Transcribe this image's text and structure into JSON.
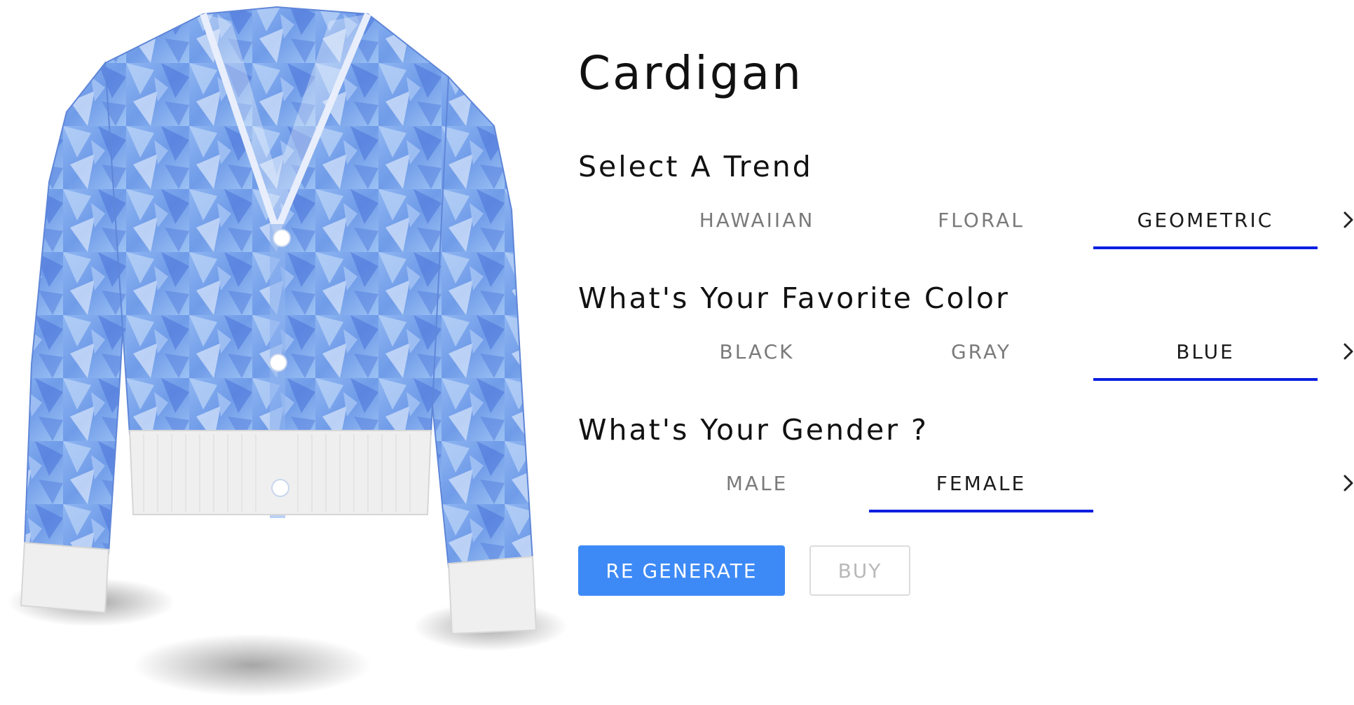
{
  "product": {
    "title": "Cardigan",
    "image_alt": "Cardigan with blue geometric pattern"
  },
  "sections": {
    "trend": {
      "title": "Select A Trend",
      "options": [
        "HAWAIIAN",
        "FLORAL",
        "GEOMETRIC"
      ],
      "selected": "GEOMETRIC"
    },
    "color": {
      "title": "What's Your Favorite Color",
      "options": [
        "BLACK",
        "GRAY",
        "BLUE"
      ],
      "selected": "BLUE"
    },
    "gender": {
      "title": "What's Your Gender ?",
      "options": [
        "MALE",
        "FEMALE"
      ],
      "selected": "FEMALE"
    }
  },
  "actions": {
    "regenerate_label": "RE GENERATE",
    "buy_label": "BUY"
  },
  "icons": {
    "next": "chevron-right-icon"
  },
  "colors": {
    "accent_underline": "#0a1fe0",
    "primary_button": "#3d8af7",
    "garment_blue": "#6f9be8",
    "ribbing": "#efefef"
  }
}
